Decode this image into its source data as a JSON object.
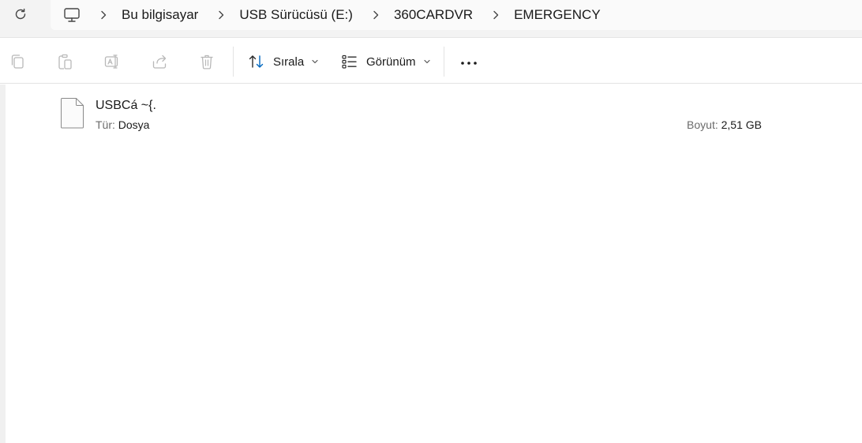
{
  "breadcrumb": {
    "items": [
      "Bu bilgisayar",
      "USB Sürücüsü (E:)",
      "360CARDVR",
      "EMERGENCY"
    ]
  },
  "toolbar": {
    "sort_label": "Sırala",
    "view_label": "Görünüm"
  },
  "file": {
    "name": "USBCá ~{.",
    "type_key": "Tür:",
    "type_value": "Dosya",
    "size_key": "Boyut:",
    "size_value": "2,51 GB"
  },
  "icons": {
    "refresh": "refresh-icon",
    "computer": "computer-icon",
    "copy": "copy-icon",
    "paste": "paste-icon",
    "rename": "rename-icon",
    "share": "share-icon",
    "delete": "delete-icon",
    "sort": "sort-icon",
    "view": "view-icon",
    "more": "more-icon",
    "file": "file-icon"
  },
  "colors": {
    "accent": "#0067c0",
    "disabled_icon": "#b8b8b8",
    "address_bg": "#f3f3f3"
  }
}
